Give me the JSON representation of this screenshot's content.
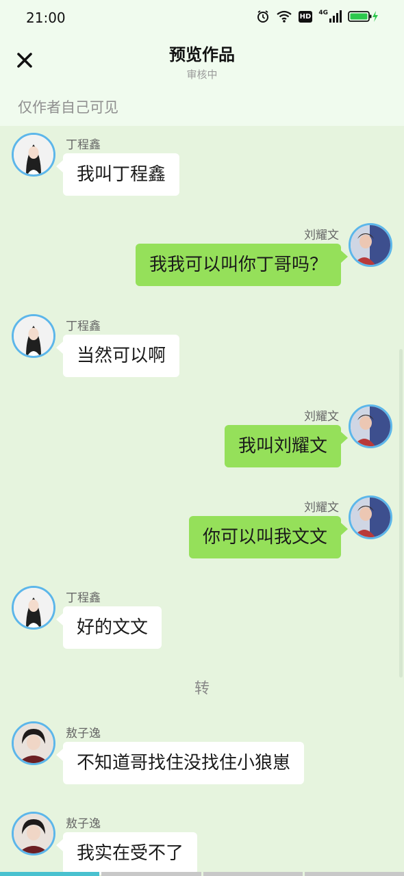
{
  "status_bar": {
    "time": "21:00",
    "net_label": "4G",
    "hd_label": "HD"
  },
  "header": {
    "title": "预览作品",
    "subtitle": "审核中",
    "visibility": "仅作者自己可见"
  },
  "messages": [
    {
      "side": "left",
      "name": "丁程鑫",
      "text": "我叫丁程鑫",
      "avatar": "ding-avatar"
    },
    {
      "side": "right",
      "name": "刘耀文",
      "text": "我我可以叫你丁哥吗？",
      "avatar": "liu-avatar"
    },
    {
      "side": "left",
      "name": "丁程鑫",
      "text": "当然可以啊",
      "avatar": "ding-avatar"
    },
    {
      "side": "right",
      "name": "刘耀文",
      "text": "我叫刘耀文",
      "avatar": "liu-avatar"
    },
    {
      "side": "right",
      "name": "刘耀文",
      "text": "你可以叫我文文",
      "avatar": "liu-avatar"
    },
    {
      "side": "left",
      "name": "丁程鑫",
      "text": "好的文文",
      "avatar": "ding-avatar"
    },
    {
      "side": "left",
      "name": "敖子逸",
      "text": "不知道哥找住没找住小狼崽",
      "avatar": "ao-avatar"
    },
    {
      "side": "left",
      "name": "敖子逸",
      "text": "我实在受不了",
      "avatar": "ao-avatar"
    }
  ],
  "divider": "转",
  "colors": {
    "header_bg": "#f0fbee",
    "chat_bg": "#e6f4de",
    "bubble_self": "#95e05a",
    "bubble_other": "#ffffff",
    "avatar_ring": "#5cb6ea",
    "progress_active": "#49c1cf"
  },
  "playback": {
    "segments": 4,
    "current_segment": 1,
    "current_segment_progress": 1.0
  }
}
